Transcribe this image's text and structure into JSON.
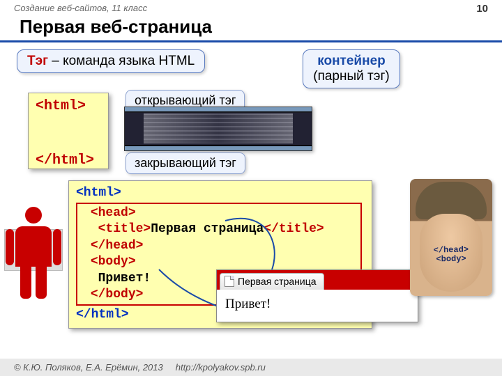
{
  "header": {
    "course": "Создание веб-сайтов, 11 класс",
    "page": "10"
  },
  "title": "Первая веб-страница",
  "callouts": {
    "tag_def_hl": "Тэг",
    "tag_def_rest": " – команда языка HTML",
    "container_top": "контейнер",
    "container_bottom": "(парный тэг)",
    "open_tag": "открывающий тэг",
    "close_tag": "закрывающий тэг"
  },
  "code_small": {
    "open": "<html>",
    "close": "</html>"
  },
  "code_big": {
    "l1": "<html>",
    "l2a": "<head>",
    "l3a_open": "<title>",
    "l3a_text": "Первая страница",
    "l3a_close": "</title>",
    "l4a": "</head>",
    "l5a": "<body>",
    "l6a": "Привет!",
    "l7a": "</body>",
    "l8": "</html>"
  },
  "browser": {
    "tab_title": "Первая страница",
    "body_text": "Привет!"
  },
  "tattoo": {
    "l1": "</head>",
    "l2": "<body>"
  },
  "footer": {
    "copyright": "© К.Ю. Поляков, Е.А. Ерёмин, 2013",
    "url": "http://kpolyakov.spb.ru"
  }
}
